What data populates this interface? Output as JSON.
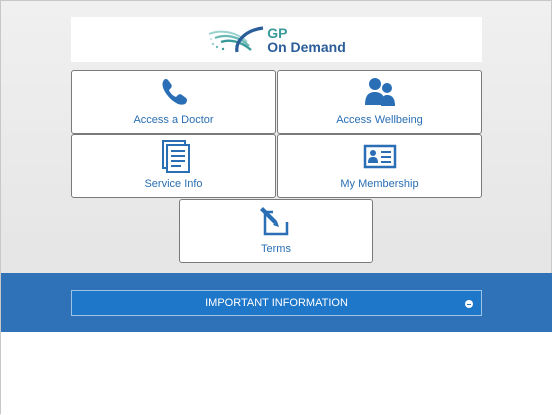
{
  "brand": {
    "line1": "GP",
    "line2": "On Demand"
  },
  "tiles": [
    {
      "label": "Access a Doctor",
      "icon": "phone-icon"
    },
    {
      "label": "Access Wellbeing",
      "icon": "people-icon"
    },
    {
      "label": "Service Info",
      "icon": "document-icon"
    },
    {
      "label": "My Membership",
      "icon": "id-card-icon"
    },
    {
      "label": "Terms",
      "icon": "edit-icon"
    }
  ],
  "info": {
    "label": "IMPORTANT INFORMATION",
    "toggle_icon": "collapse-icon"
  },
  "colors": {
    "accent": "#2a6fb5",
    "band": "#2f72b8",
    "info_bar": "#1f77c9"
  }
}
